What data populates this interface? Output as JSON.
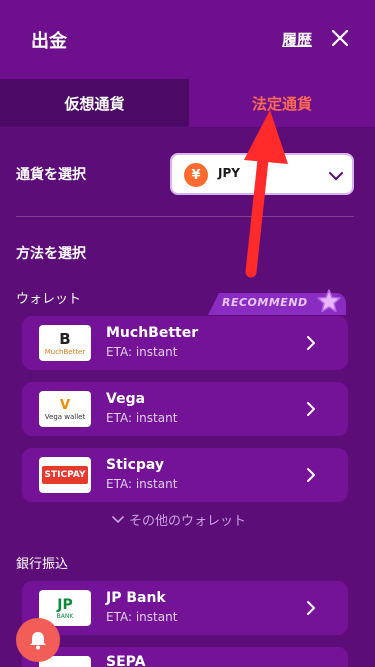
{
  "header": {
    "title": "出金",
    "history_label": "履歴"
  },
  "tabs": [
    {
      "label": "仮想通貨",
      "active": false
    },
    {
      "label": "法定通貨",
      "active": true
    }
  ],
  "currency": {
    "label": "通貨を選択",
    "selected": "JPY",
    "coin_symbol": "¥"
  },
  "method": {
    "label": "方法を選択"
  },
  "wallets": {
    "label": "ウォレット",
    "recommend_badge": "RECOMMEND",
    "items": [
      {
        "name": "MuchBetter",
        "eta": "ETA: instant",
        "logo_text": "MuchBetter"
      },
      {
        "name": "Vega",
        "eta": "ETA: instant",
        "logo_text": "Vega wallet"
      },
      {
        "name": "Sticpay",
        "eta": "ETA: instant",
        "logo_text": "STICPAY"
      }
    ],
    "more_label": "その他のウォレット"
  },
  "bank": {
    "label": "銀行振込",
    "items": [
      {
        "name": "JP Bank",
        "eta": "ETA: instant",
        "logo_text": "BANK"
      },
      {
        "name": "SEPA"
      }
    ]
  },
  "colors": {
    "background": "#5c0d78",
    "header": "#6e108e",
    "card": "#741298",
    "accent": "#ff6a53",
    "annotation_arrow": "#ff2b2b",
    "bell": "#f25d57"
  }
}
